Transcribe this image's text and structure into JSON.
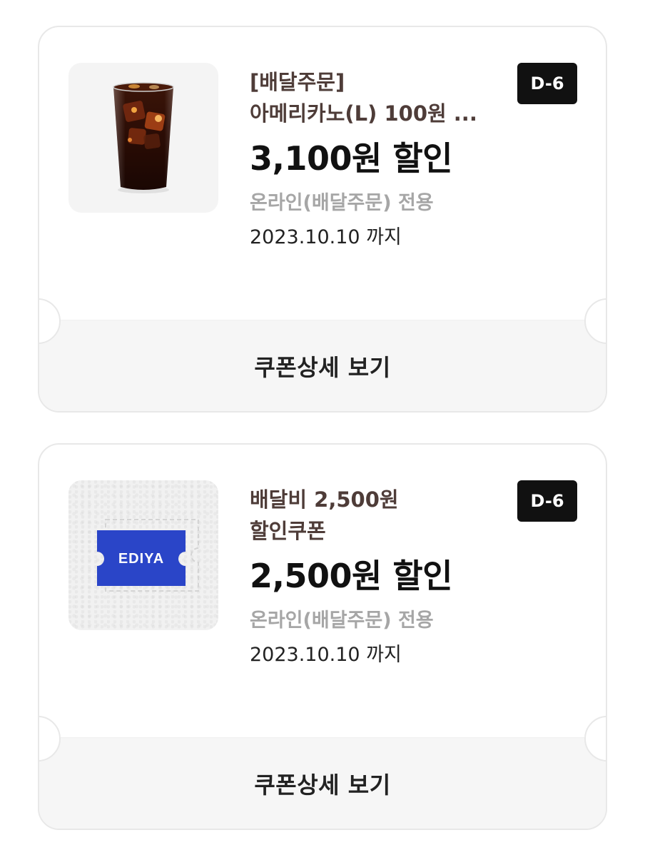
{
  "coupons": [
    {
      "title_lines": [
        "[배달주문]",
        "아메리카노(L) 100원 ..."
      ],
      "dday": "D-6",
      "discount": "3,100원 할인",
      "channel": "온라인(배달주문) 전용",
      "expiry": "2023.10.10 까지",
      "detail_label": "쿠폰상세 보기",
      "image": "iced-americano-icon"
    },
    {
      "title_lines": [
        "배달비 2,500원",
        "할인쿠폰"
      ],
      "dday": "D-6",
      "discount": "2,500원 할인",
      "channel": "온라인(배달주문) 전용",
      "expiry": "2023.10.10 까지",
      "detail_label": "쿠폰상세 보기",
      "image": "ediya-ticket-icon",
      "brand_text": "EDIYA",
      "brand_color": "#2a45c8"
    }
  ]
}
